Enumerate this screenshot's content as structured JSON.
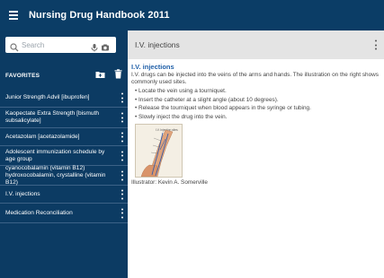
{
  "app": {
    "title": "Nursing Drug Handbook 2011",
    "menu_icon": "hamburger-menu-icon"
  },
  "search": {
    "placeholder": "Search"
  },
  "favorites": {
    "header": "FAVORITES",
    "items": [
      {
        "label": "Junior Strength Advil [ibuprofen]"
      },
      {
        "label": "Kaopectate Extra Strength [bismuth subsalicylate]"
      },
      {
        "label": "Acetazolam [acetazolamide]"
      },
      {
        "label": "Adolescent immunization schedule by age group"
      },
      {
        "label": "cyanocobalamin (vitamin B12) hydroxocobalamin, crystalline (vitamin B12)"
      },
      {
        "label": "I.V. injections"
      },
      {
        "label": "Medication Reconciliation"
      }
    ]
  },
  "detail": {
    "header_title": "I.V. injections",
    "title": "I.V. injections",
    "intro": "I.V. drugs can be injected into the veins of the arms and hands. The illustration on the right shows commonly used sites.",
    "steps": [
      "Locate the vein using a tourniquet.",
      "Insert the catheter at a slight angle (about 10 degrees).",
      "Release the tourniquet when blood appears in the syringe or tubing.",
      "Slowly inject the drug into the vein."
    ],
    "illustration_label": "I.V. Injection sites",
    "credit": "Illustrator: Kevin A. Somerville"
  },
  "colors": {
    "appbar": "#0b3d66",
    "sidebar": "#0c3b63",
    "link": "#1f5fa8",
    "header_bg": "#e4e4e4"
  }
}
